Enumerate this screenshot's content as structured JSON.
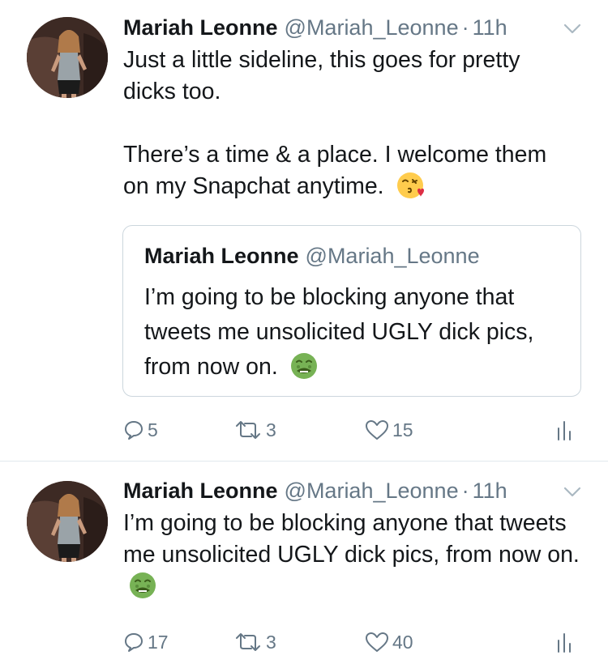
{
  "tweets": [
    {
      "author_name": "Mariah Leonne",
      "handle": "@Mariah_Leonne",
      "separator": "·",
      "time": "11h",
      "text_line1": "Just a little sideline, this goes for pretty dicks too.",
      "text_line2": "There’s a time & a place.  I welcome them on my Snapchat anytime.",
      "text_emoji": "kissing-face-with-heart-emoji",
      "quoted": {
        "author_name": "Mariah Leonne",
        "handle": "@Mariah_Leonne",
        "text": "I’m going to be blocking anyone that tweets me unsolicited UGLY dick pics, from now on.",
        "emoji": "nauseated-face-emoji"
      },
      "replies": "5",
      "retweets": "3",
      "likes": "15"
    },
    {
      "author_name": "Mariah Leonne",
      "handle": "@Mariah_Leonne",
      "separator": "·",
      "time": "11h",
      "text": "I’m going to be blocking anyone that tweets me unsolicited UGLY dick pics, from now on.",
      "text_emoji": "nauseated-face-emoji",
      "replies": "17",
      "retweets": "3",
      "likes": "40"
    }
  ],
  "colors": {
    "text": "#14171a",
    "secondary": "#657786",
    "border": "#ccd6dd",
    "divider": "#e1e8ed"
  }
}
